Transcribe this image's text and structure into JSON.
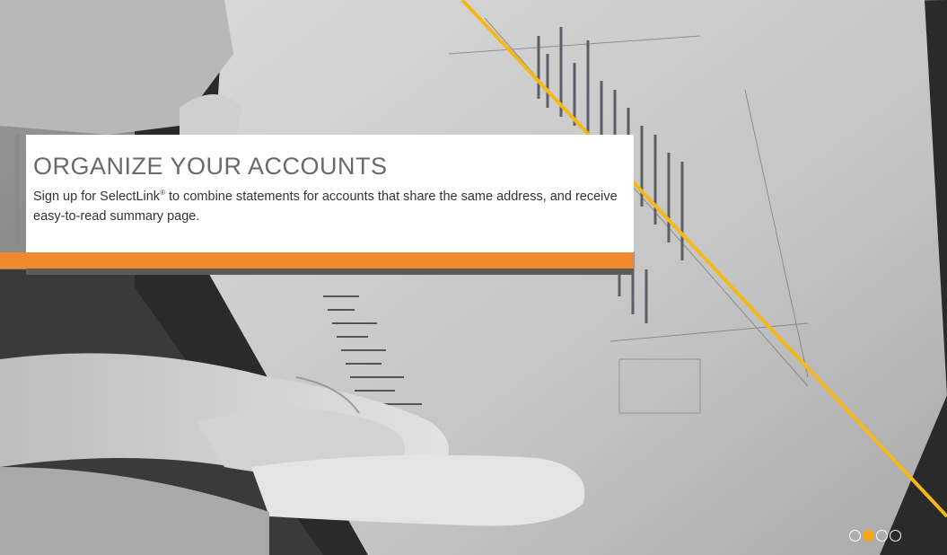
{
  "slide": {
    "title": "ORGANIZE YOUR ACCOUNTS",
    "text_before_mark": "Sign up for SelectLink",
    "registered_mark": "®",
    "text_after_mark": " to combine statements for accounts that share the same address, and receive easy-to-read summary page."
  },
  "carousel": {
    "total_slides": 4,
    "active_index": 1
  },
  "colors": {
    "accent_orange": "#f08a2c",
    "accent_line": "#f5b81a",
    "active_dot": "#f5a51d"
  },
  "background_image": {
    "description_icon": "tablet-chart-photo"
  }
}
